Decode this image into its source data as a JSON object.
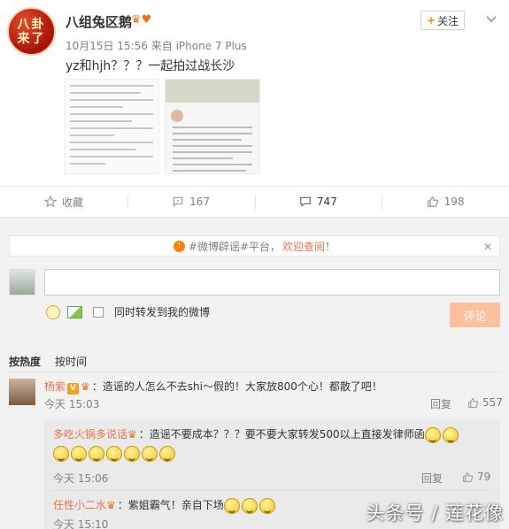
{
  "post": {
    "author": "八组兔区鹅",
    "avatar_text": "八卦来了",
    "meta": "10月15日 15:56 来自 iPhone 7 Plus",
    "follow_label": "关注",
    "text": "yz和hjh？？？一起拍过战长沙"
  },
  "actions": {
    "favorite": "收藏",
    "repost": "167",
    "comment": "747",
    "like": "198"
  },
  "notice": {
    "prefix": "#微博辟谣#平台，",
    "link": "欢迎查阅",
    "suffix": "！",
    "close": "✕"
  },
  "composer": {
    "repost_label": "同时转发到我的微博",
    "submit_label": "评论"
  },
  "sort": {
    "hot": "按热度",
    "time": "按时间"
  },
  "comments": [
    {
      "name": "杨紫",
      "text": "：造谣的人怎么不去shi～假的！大家放800个心！都散了吧！",
      "time": "今天 15:03",
      "reply": "回复",
      "likes": "557"
    },
    {
      "name": "多吃火锅多说话",
      "text": "：造谣不要成本？？？要不要大家转发500以上直接发律师函",
      "time": "今天 15:06",
      "reply": "回复",
      "likes": "79"
    },
    {
      "name": "任性小二水",
      "text": "：紫姐霸气！亲自下场",
      "time": "今天 15:10"
    }
  ],
  "watermark": "头条号 / 莲花像",
  "colors": {
    "accent": "#eb7350",
    "follow_plus": "#ff8200",
    "submit_disabled": "#ffc09f"
  }
}
